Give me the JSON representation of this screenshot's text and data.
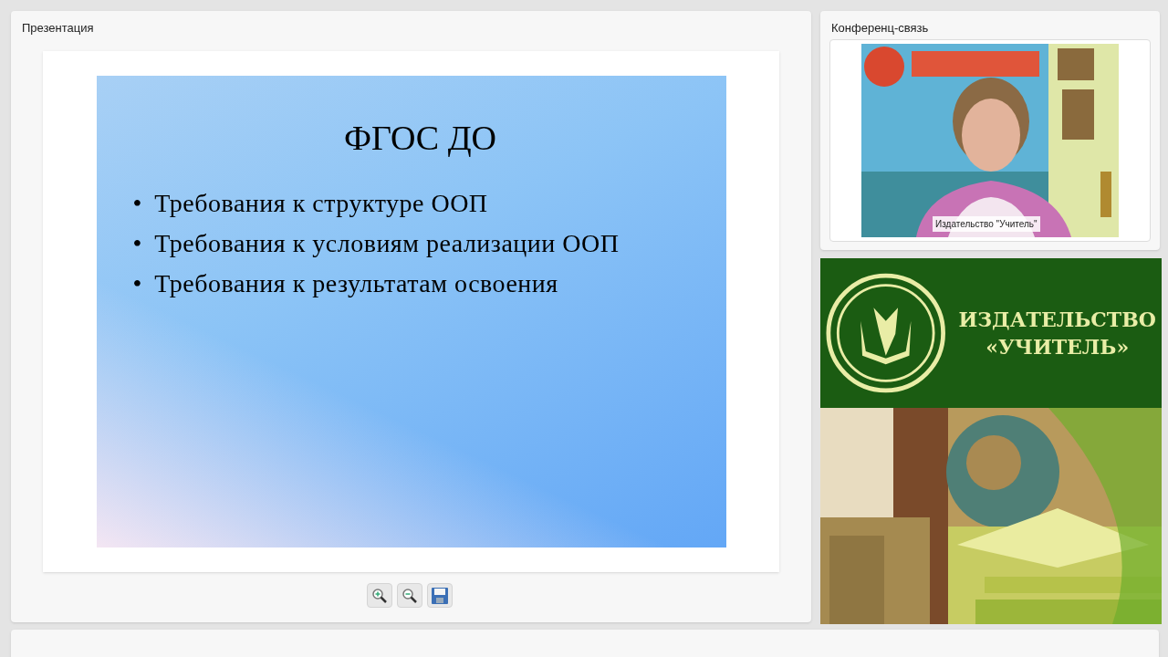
{
  "presentation": {
    "title": "Презентация",
    "slide": {
      "heading": "ФГОС ДО",
      "bullets": [
        {
          "marker": "•",
          "text": "Требования к структуре ООП"
        },
        {
          "marker": "•",
          "text": "Требования к условиям реализации ООП"
        },
        {
          "marker": "•",
          "text": "Требования к результатам освоения"
        }
      ]
    },
    "toolbar": [
      {
        "kind": "zoom-in"
      },
      {
        "kind": "zoom-out"
      },
      {
        "kind": "save"
      }
    ]
  },
  "conference": {
    "title": "Конференц-связь",
    "video": {
      "kind": "picture",
      "caption": "Издательство \"Учитель\""
    }
  },
  "banner": {
    "lines": [
      "ИЗДАТЕЛЬСТВО",
      "«УЧИТЕЛЬ»"
    ],
    "photo": {
      "kind": "picture"
    }
  }
}
